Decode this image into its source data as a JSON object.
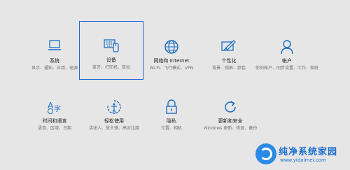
{
  "tiles": [
    {
      "id": "system",
      "title": "系统",
      "desc": "显示、通知、应用、电源",
      "icon": "laptop-icon"
    },
    {
      "id": "devices",
      "title": "设备",
      "desc": "蓝牙、打印机、鼠标",
      "icon": "keyboard-device-icon"
    },
    {
      "id": "network",
      "title": "网络和 Internet",
      "desc": "Wi-Fi、飞行模式、VPN",
      "icon": "globe-icon"
    },
    {
      "id": "personalization",
      "title": "个性化",
      "desc": "背景、锁屏、颜色",
      "icon": "paint-brush-icon"
    },
    {
      "id": "accounts",
      "title": "帐户",
      "desc": "你的帐户、同步设置、工作、家庭",
      "icon": "person-icon"
    },
    {
      "id": "time",
      "title": "时间和语言",
      "desc": "语音、区域、日期",
      "icon": "time-language-icon"
    },
    {
      "id": "ease",
      "title": "轻松使用",
      "desc": "讲述人、放大镜、高对比度",
      "icon": "ease-of-access-icon"
    },
    {
      "id": "privacy",
      "title": "隐私",
      "desc": "位置、相机",
      "icon": "lock-icon"
    },
    {
      "id": "update",
      "title": "更新和安全",
      "desc": "Windows 更新、恢复、备份",
      "icon": "refresh-icon"
    }
  ],
  "watermark": {
    "title": "纯净系统家园",
    "url": "www.yidaimei.com"
  },
  "colors": {
    "icon": "#1a6ec2",
    "selected_border": "#2463d9",
    "background": "#e6e6e6"
  }
}
